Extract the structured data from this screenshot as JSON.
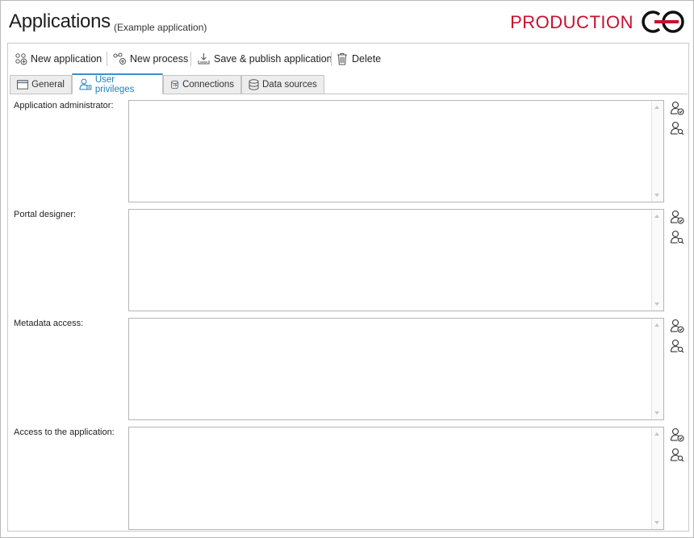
{
  "header": {
    "title": "Applications",
    "subtitle": "(Example application)",
    "environment": "PRODUCTION",
    "environment_color": "#c8102e",
    "logo_icon": "webcon-logo-icon"
  },
  "toolbar": {
    "new_application": "New application",
    "new_process": "New process",
    "save_publish": "Save & publish application",
    "delete": "Delete"
  },
  "tabs": [
    {
      "label": "General",
      "icon": "window-icon"
    },
    {
      "label": "User privileges",
      "icon": "users-icon",
      "active": true
    },
    {
      "label": "Connections",
      "icon": "connections-icon"
    },
    {
      "label": "Data sources",
      "icon": "database-icon"
    }
  ],
  "fields": [
    {
      "label": "Application administrator:",
      "value": ""
    },
    {
      "label": "Portal designer:",
      "value": ""
    },
    {
      "label": "Metadata access:",
      "value": ""
    },
    {
      "label": "Access to the application:",
      "value": ""
    }
  ],
  "accent_color": "#3a8fd1"
}
